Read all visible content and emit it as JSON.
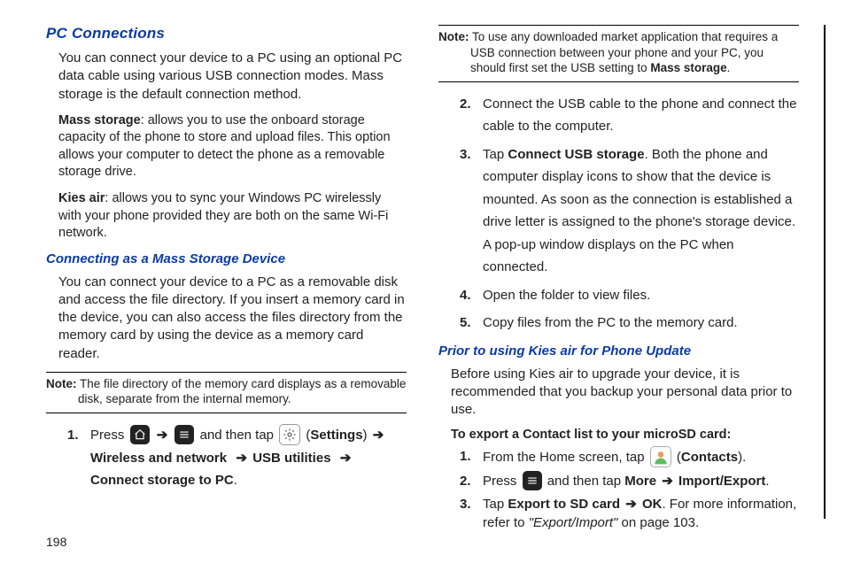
{
  "page_number": "198",
  "left": {
    "heading": "PC Connections",
    "intro": "You can connect your device to a PC using an optional PC data cable using various USB connection modes. Mass storage is the default connection method.",
    "mass_label": "Mass storage",
    "mass_text": ": allows you to use the onboard storage capacity of the phone to store and upload files. This option allows your computer to detect the phone as a removable storage drive.",
    "kies_label": "Kies air",
    "kies_text": ": allows you to sync your Windows PC wirelessly with your phone provided they are both on the same Wi-Fi network.",
    "sub1": "Connecting as a Mass Storage Device",
    "sub1_body": "You can connect your device to a PC as a removable disk and access the file directory. If you insert a memory card in the device, you can also access the files directory from the memory card by using the device as a memory card reader.",
    "note_label": "Note:",
    "note_text": " The file directory of the memory card displays as a removable disk, separate from the internal memory.",
    "step1_a": "Press ",
    "step1_b": " and then tap ",
    "step1_settings": "Settings",
    "step1_c": "Wireless and network",
    "step1_d": "USB utilities",
    "step1_e": "Connect storage to PC",
    "arrow": "➔"
  },
  "right": {
    "note_label": "Note:",
    "note_a": " To use any downloaded market application that requires a USB connection between your phone and your PC, you should first set the USB setting to ",
    "note_b": "Mass storage",
    "step2": "Connect the USB cable to the phone and connect the cable to the computer.",
    "step3_a": "Tap ",
    "step3_b": "Connect USB storage",
    "step3_c": ". Both the phone and computer display icons to show that the device is mounted. As soon as the connection is established a drive letter is assigned to the phone's storage device.",
    "step3_d": "A pop-up window displays on the PC when connected.",
    "step4": "Open the folder to view files.",
    "step5": "Copy files from the PC to the memory card.",
    "sub2": "Prior to using Kies air for Phone Update",
    "sub2_body": "Before using Kies air to upgrade your device, it is recommended that you backup your personal data prior to use.",
    "export_heading": "To export a Contact list to your microSD card:",
    "e1_a": "From the Home screen, tap ",
    "e1_b": "Contacts",
    "e2_a": "Press ",
    "e2_b": " and then tap ",
    "e2_c": "More",
    "e2_d": "Import/Export",
    "e3_a": "Tap ",
    "e3_b": "Export to SD card",
    "e3_c": "OK",
    "e3_d": ". For more information, refer to ",
    "e3_e": "\"Export/Import\"",
    "e3_f": "  on page 103."
  }
}
